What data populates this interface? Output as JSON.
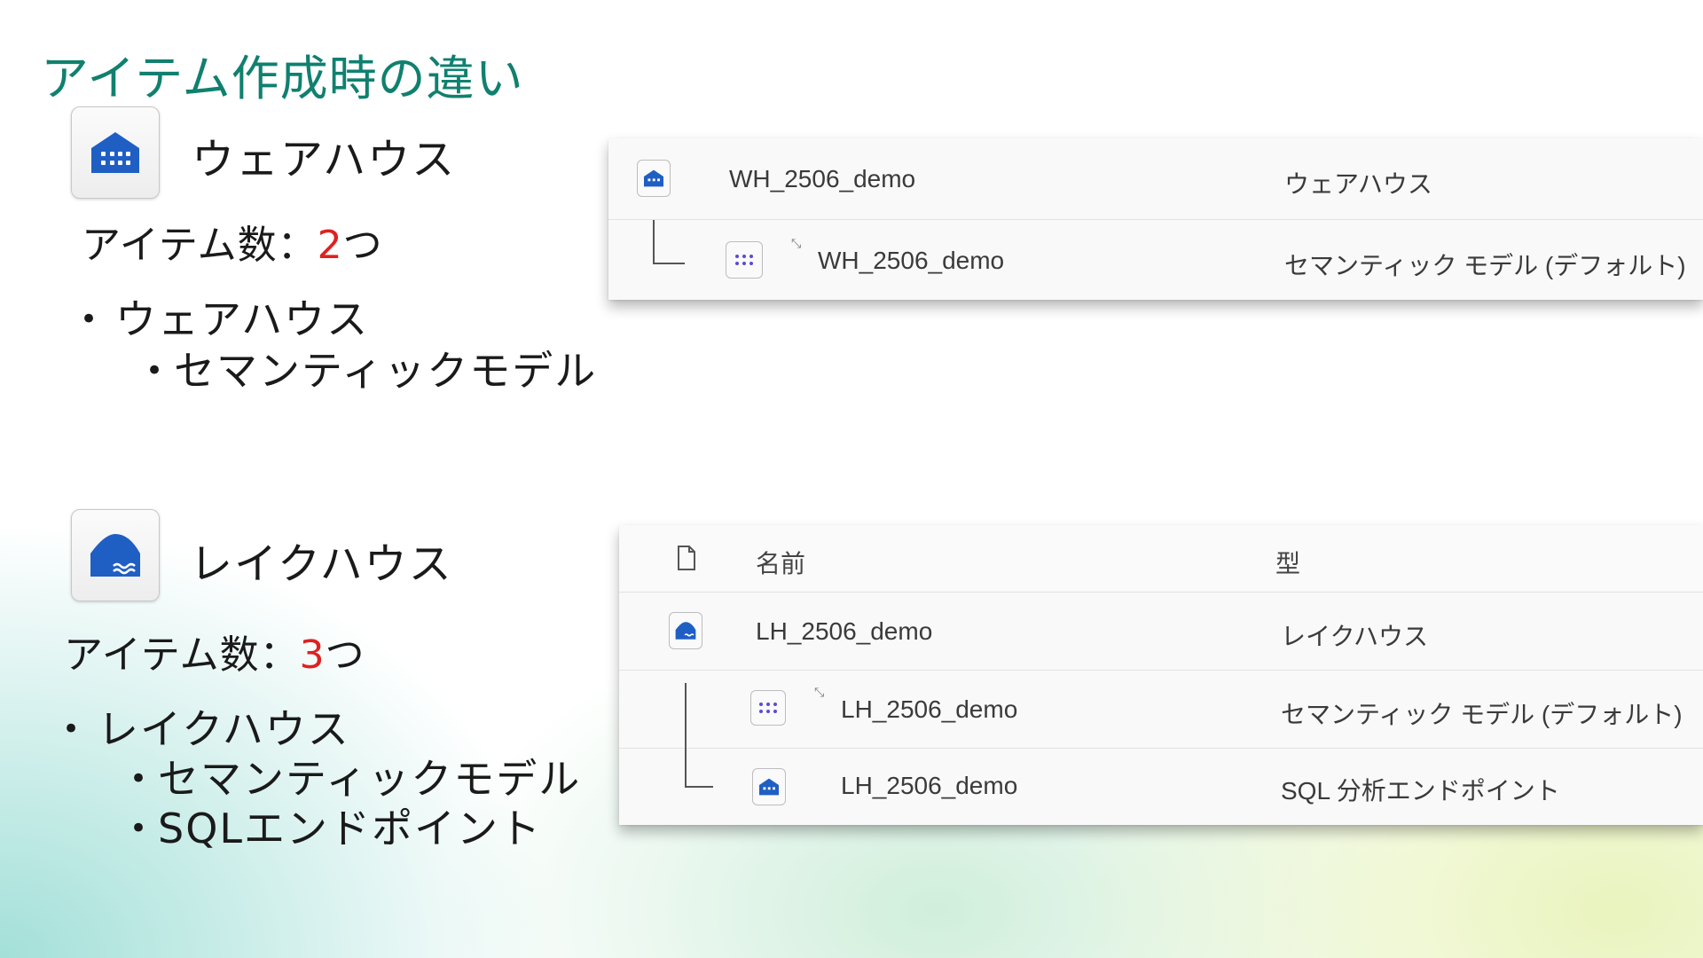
{
  "title": "アイテム作成時の違い",
  "warehouse": {
    "heading": "ウェアハウス",
    "count_prefix": "アイテム数：",
    "count_number": "2",
    "count_suffix": "つ",
    "bullets": [
      "ウェアハウス"
    ],
    "sub_bullets": [
      "セマンティックモデル"
    ],
    "table": {
      "rows": [
        {
          "name": "WH_2506_demo",
          "type": "ウェアハウス",
          "icon": "warehouse-icon"
        },
        {
          "name": "WH_2506_demo",
          "type": "セマンティック モデル (デフォルト)",
          "icon": "semantic-model-icon"
        }
      ]
    }
  },
  "lakehouse": {
    "heading": "レイクハウス",
    "count_prefix": "アイテム数：",
    "count_number": "3",
    "count_suffix": "つ",
    "bullets": [
      "レイクハウス"
    ],
    "sub_bullets": [
      "セマンティックモデル",
      "SQLエンドポイント"
    ],
    "table": {
      "header": {
        "name": "名前",
        "type": "型",
        "icon": "file-icon"
      },
      "rows": [
        {
          "name": "LH_2506_demo",
          "type": "レイクハウス",
          "icon": "lakehouse-icon"
        },
        {
          "name": "LH_2506_demo",
          "type": "セマンティック モデル (デフォルト)",
          "icon": "semantic-model-icon"
        },
        {
          "name": "LH_2506_demo",
          "type": "SQL 分析エンドポイント",
          "icon": "warehouse-icon"
        }
      ]
    }
  },
  "bullet_glyph": "•",
  "colors": {
    "title": "#10806f",
    "count_number": "#e02020",
    "icon_blue": "#1f5fc4"
  }
}
